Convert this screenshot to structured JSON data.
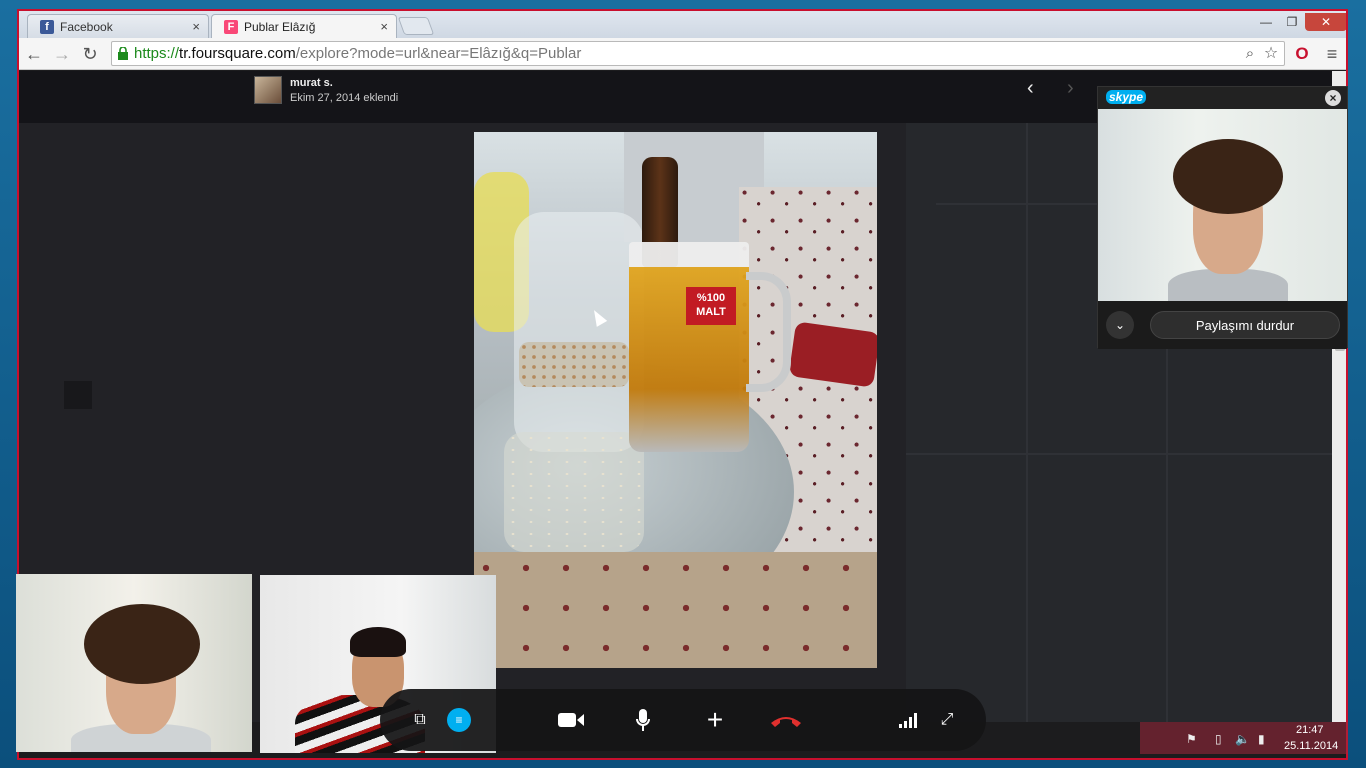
{
  "browser": {
    "tabs": [
      {
        "title": "Facebook",
        "favicon": "f"
      },
      {
        "title": "Publar Elâzığ",
        "favicon": "F"
      }
    ],
    "url": {
      "scheme": "https://",
      "host": "tr.foursquare.com",
      "path": "/explore?mode=url&near=Elâzığ&q=Publar"
    },
    "colors": {
      "accent_red": "#c8102e",
      "secure_green": "#1c8a1c"
    }
  },
  "photo_viewer": {
    "uploader_name": "murat s.",
    "upload_date": "Ekim 27, 2014 eklendi",
    "prev_label": "‹",
    "next_label": "›",
    "beer_label_line1": "%100",
    "beer_label_line2": "MALT"
  },
  "skype": {
    "logo": "skype",
    "stop_sharing_label": "Paylaşımı durdur",
    "close_label": "×",
    "expand_label": "⌄"
  },
  "call_bar": {
    "icons": [
      "share-screen-icon",
      "chat-icon",
      "video-camera-icon",
      "microphone-icon",
      "add-icon",
      "hang-up-icon",
      "signal-icon",
      "fullscreen-exit-icon"
    ]
  },
  "taskbar": {
    "time": "21:47",
    "date": "25.11.2014"
  }
}
